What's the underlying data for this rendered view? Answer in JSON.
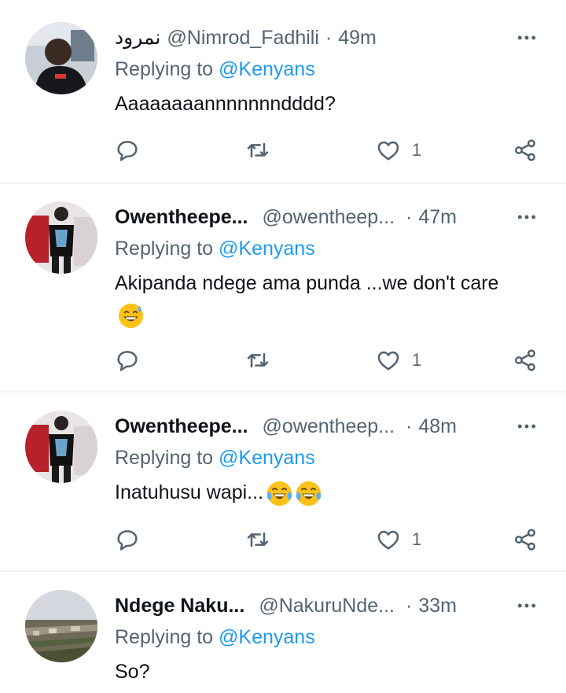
{
  "tweets": [
    {
      "name": "نمرود",
      "handle": "@Nimrod_Fadhili",
      "dot": "·",
      "time": "49m",
      "replying_prefix": "Replying to",
      "replying_to": "@Kenyans",
      "text": "Aaaaaaaannnnnnndddd?",
      "emojis": [],
      "likes": "1"
    },
    {
      "name": "Owentheepe...",
      "handle": "@owentheep...",
      "dot": "·",
      "time": "47m",
      "replying_prefix": "Replying to",
      "replying_to": "@Kenyans",
      "text": "Akipanda ndege ama punda ...we don't care",
      "emojis": [
        "grinning-sweat-emoji"
      ],
      "likes": "1"
    },
    {
      "name": "Owentheepe...",
      "handle": "@owentheep...",
      "dot": "·",
      "time": "48m",
      "replying_prefix": "Replying to",
      "replying_to": "@Kenyans",
      "text": "Inatuhusu wapi...",
      "emojis": [
        "tears-of-joy-emoji",
        "tears-of-joy-emoji"
      ],
      "likes": "1"
    },
    {
      "name": "Ndege Naku...",
      "handle": "@NakuruNde...",
      "dot": "·",
      "time": "33m",
      "replying_prefix": "Replying to",
      "replying_to": "@Kenyans",
      "text": "So?",
      "emojis": []
    }
  ],
  "icons": {
    "reply": "reply-icon",
    "retweet": "retweet-icon",
    "like": "like-icon",
    "share": "share-icon",
    "more": "more-icon"
  },
  "colors": {
    "text": "#0f1419",
    "secondary": "#536471",
    "link": "#1d9bf0",
    "divider": "#eff3f4"
  }
}
